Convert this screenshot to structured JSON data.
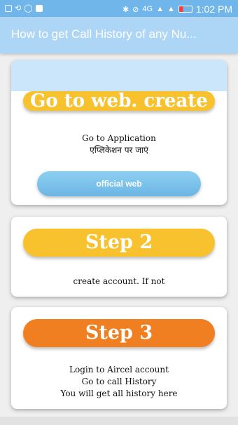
{
  "status": {
    "time": "1:02 PM",
    "network": "4G"
  },
  "app_bar": {
    "title": "How to get Call History of any Nu..."
  },
  "cards": [
    {
      "heading": "Go to web. create",
      "lines": [
        "Go to Application",
        "एप्लिकेशन पर जाएं"
      ],
      "button": "official web"
    },
    {
      "heading": "Step 2",
      "lines": [
        "create account. If not"
      ]
    },
    {
      "heading": "Step 3",
      "lines": [
        "Login to Aircel account",
        "Go to call History",
        "You will get all history here"
      ]
    }
  ],
  "colors": {
    "status_bar": "#71b6ea",
    "app_bar": "#add5f6",
    "pill_yellow": "#f7c22d",
    "pill_orange": "#f07f21",
    "button": "#7bc3ec"
  }
}
